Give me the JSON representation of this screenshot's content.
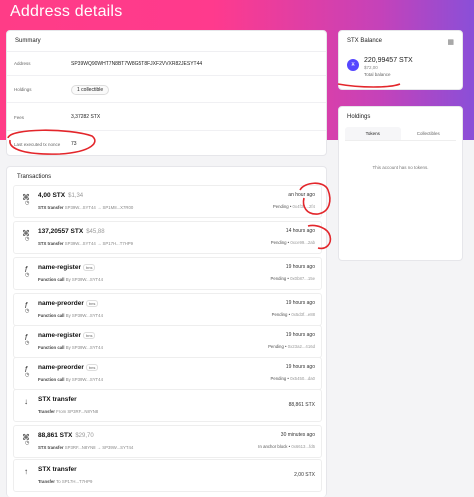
{
  "page": {
    "title": "Address details"
  },
  "summary": {
    "heading": "Summary",
    "rows": [
      {
        "key": "Address",
        "value": "SP39WQ90WHT7N8BT7W8G5T8FJXF2VVXR82JESYT44"
      },
      {
        "key": "Holdings",
        "value": "1 collectible"
      },
      {
        "key": "Fees",
        "value": "3,37282 STX"
      },
      {
        "key": "Last executed tx nonce",
        "value": "73"
      }
    ]
  },
  "balance": {
    "heading": "STX Balance",
    "amount": "220,99457 STX",
    "usd": "$72,00",
    "label": "Total balance",
    "icon": "stx-icon"
  },
  "holdings": {
    "heading": "Holdings",
    "tabs": [
      "Tokens",
      "Collectibles"
    ],
    "empty_text": "This account has no tokens."
  },
  "transactions": {
    "heading": "Transactions",
    "items": [
      {
        "icon": "token-transfer-icon",
        "title": "4,00 STX",
        "usd": "$1,34",
        "tag": "",
        "sub_label": "STX transfer",
        "sub_meta": "SP39W...SYT44 → SP1M8...X7R00",
        "time": "an hour ago",
        "status": "Pending",
        "hash": "0x4f35...2f4"
      },
      {
        "icon": "token-transfer-icon",
        "title": "137,20557 STX",
        "usd": "$45,88",
        "tag": "",
        "sub_label": "STX transfer",
        "sub_meta": "SP39W...SYT44 → SP17H...T7HP9",
        "time": "14 hours ago",
        "status": "Pending",
        "hash": "0xce99...2ab"
      },
      {
        "icon": "function-icon",
        "title": "name-register",
        "usd": "",
        "tag": "bns",
        "sub_label": "Function call",
        "sub_meta": "By SP39W...SYT44",
        "time": "19 hours ago",
        "status": "Pending",
        "hash": "0x0b87...15e"
      },
      {
        "icon": "function-icon",
        "title": "name-preorder",
        "usd": "",
        "tag": "bns",
        "sub_label": "Function call",
        "sub_meta": "By SP39W...SYT44",
        "time": "19 hours ago",
        "status": "Pending",
        "hash": "0x5d3f...e88"
      },
      {
        "icon": "function-icon",
        "title": "name-register",
        "usd": "",
        "tag": "bns",
        "sub_label": "Function call",
        "sub_meta": "By SP39W...SYT44",
        "time": "19 hours ago",
        "status": "Pending",
        "hash": "0x23a2...416d"
      },
      {
        "icon": "function-icon",
        "title": "name-preorder",
        "usd": "",
        "tag": "bns",
        "sub_label": "Function call",
        "sub_meta": "By SP39W...SYT44",
        "time": "19 hours ago",
        "status": "Pending",
        "hash": "0x5450...da0"
      },
      {
        "icon": "arrow-down-icon",
        "title": "STX transfer",
        "usd": "",
        "tag": "",
        "sub_label": "Transfer",
        "sub_meta": "From SP3RF...N8YN8",
        "time": "",
        "status": "",
        "hash": "",
        "amount": "88,861 STX"
      },
      {
        "icon": "token-transfer-icon",
        "title": "88,861 STX",
        "usd": "$29,70",
        "tag": "",
        "sub_label": "STX transfer",
        "sub_meta": "SP3RF...N8YN8 → SP39W...SYT44",
        "time": "30 minutes ago",
        "status": "In anchor block",
        "hash": "0x6613...fd5"
      },
      {
        "icon": "arrow-up-icon",
        "title": "STX transfer",
        "usd": "",
        "tag": "",
        "sub_label": "Transfer",
        "sub_meta": "To SP17H...T7HP9",
        "time": "",
        "status": "",
        "hash": "",
        "amount": "2,00 STX"
      }
    ]
  }
}
